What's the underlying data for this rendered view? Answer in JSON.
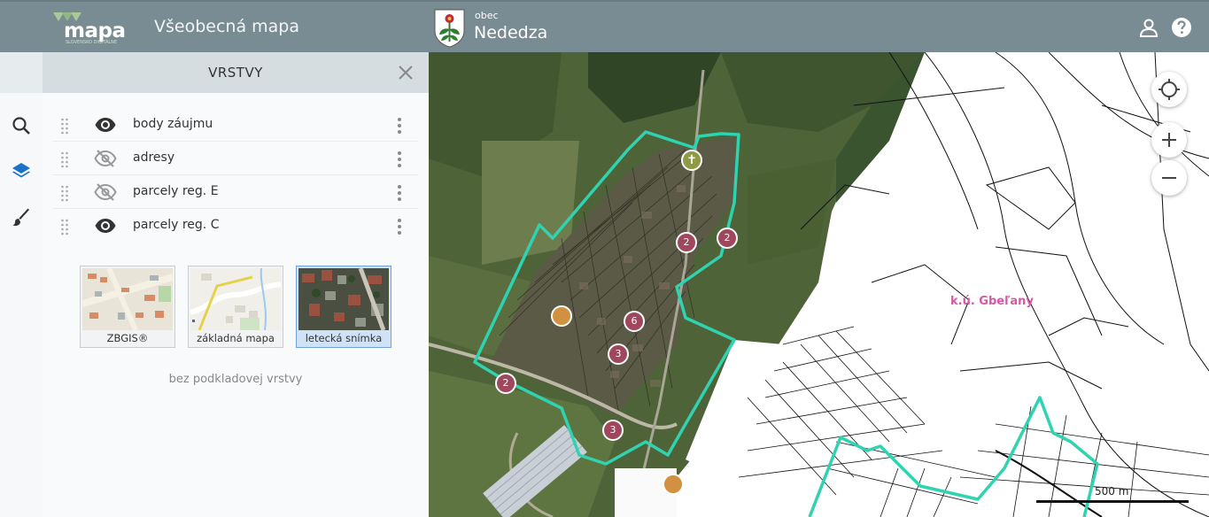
{
  "header": {
    "logo_text": "mapa",
    "logo_sub": "SLOVENSKO DIGITÁLNE",
    "app_title": "Všeobecná mapa",
    "municipality_prefix": "obec",
    "municipality_name": "Nededza"
  },
  "panel": {
    "title": "VRSTVY",
    "layers": [
      {
        "label": "body záujmu",
        "visible": true
      },
      {
        "label": "adresy",
        "visible": false
      },
      {
        "label": "parcely reg. E",
        "visible": false
      },
      {
        "label": "parcely reg. C",
        "visible": true
      }
    ],
    "basemaps": [
      {
        "label": "ZBGIS®",
        "selected": false
      },
      {
        "label": "základná mapa",
        "selected": false
      },
      {
        "label": "letecká snímka",
        "selected": true
      }
    ],
    "no_basemap_label": "bez podkladovej vrstvy"
  },
  "map": {
    "cadastral_label": "k.ú. Gbeľany",
    "scale_label": "500 m",
    "clusters": [
      "2",
      "2",
      "6",
      "3",
      "2",
      "3"
    ],
    "boundary_color": "#2fd3b0",
    "cluster_color": "#a0475e",
    "poi_color": "#d19140"
  },
  "colors": {
    "header_bg": "#7a8c93",
    "accent": "#1a73c9"
  }
}
